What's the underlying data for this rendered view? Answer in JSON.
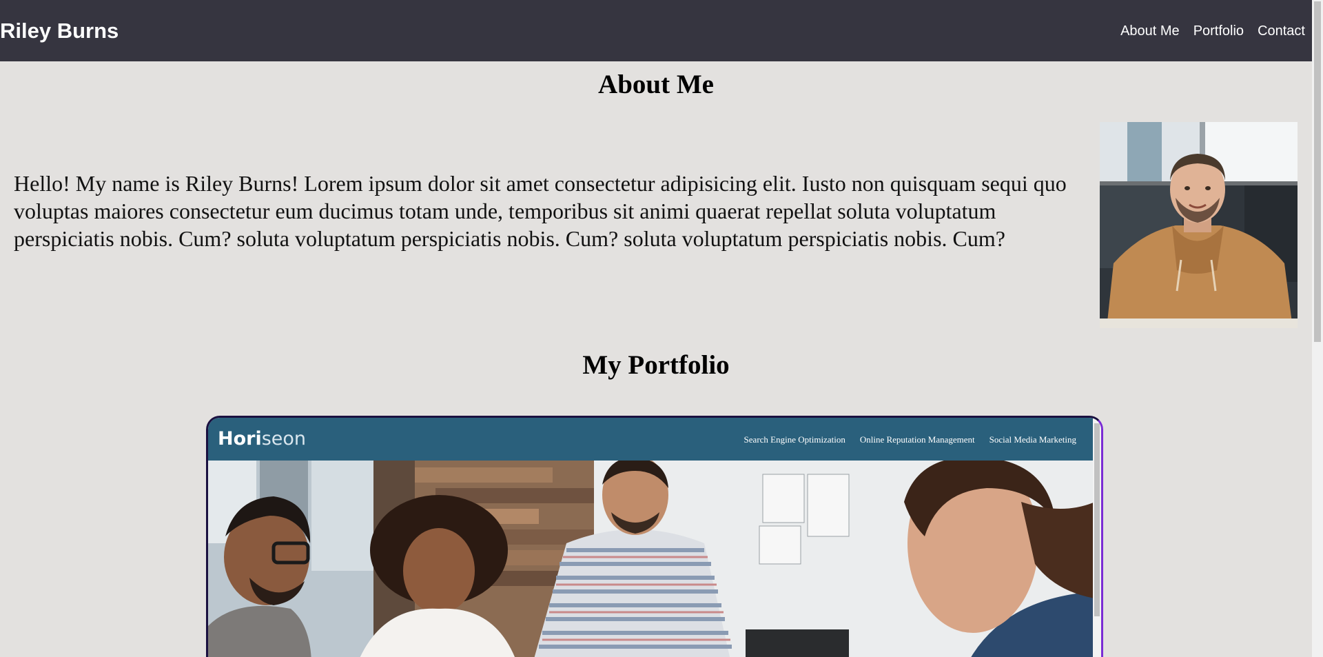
{
  "header": {
    "site_title": "Riley Burns",
    "nav": [
      "About Me",
      "Portfolio",
      "Contact"
    ]
  },
  "about": {
    "heading": "About Me",
    "text": "Hello! My name is Riley Burns! Lorem ipsum dolor sit amet consectetur adipisicing elit. Iusto non quisquam sequi quo voluptas maiores consectetur eum ducimus totam unde, temporibus sit animi quaerat repellat soluta voluptatum perspiciatis nobis. Cum? soluta voluptatum perspiciatis nobis. Cum? soluta voluptatum perspiciatis nobis. Cum?"
  },
  "portfolio": {
    "heading": "My Portfolio",
    "project": {
      "logo_primary": "Hori",
      "logo_secondary": "seon",
      "nav": [
        "Search Engine Optimization",
        "Online Reputation Management",
        "Social Media Marketing"
      ]
    }
  },
  "colors": {
    "header_bg": "#363540",
    "page_bg": "#e3e1df",
    "horiseon_bar": "#2a607c",
    "card_border_accent": "#7a2bd4"
  }
}
